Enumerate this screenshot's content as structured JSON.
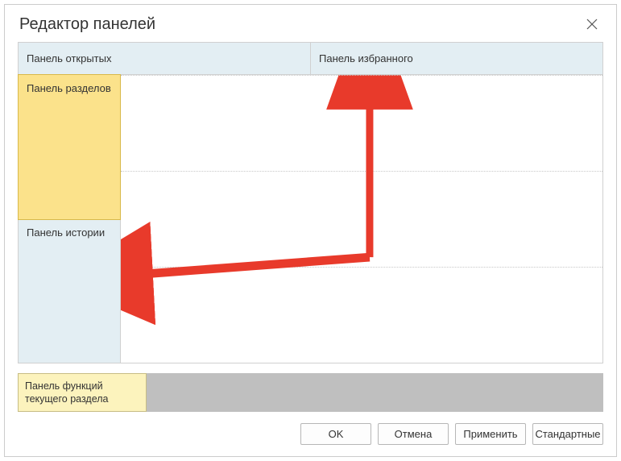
{
  "title": "Редактор панелей",
  "topRow": {
    "left": "Панель открытых",
    "right": "Панель избранного"
  },
  "leftCol": {
    "sections": "Панель разделов",
    "history": "Панель истории"
  },
  "tray": {
    "functions": "Панель функций текущего раздела"
  },
  "buttons": {
    "ok": "OK",
    "cancel": "Отмена",
    "apply": "Применить",
    "defaults": "Стандартные"
  },
  "colors": {
    "paleBlue": "#e3eef3",
    "selected": "#fbe28b",
    "trayBg": "#bfbfbf",
    "trayItem": "#fcf3bd",
    "arrow": "#e83a2b"
  }
}
